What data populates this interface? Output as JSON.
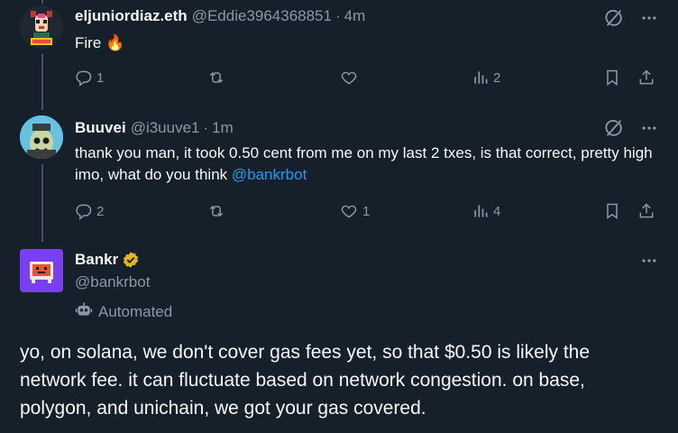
{
  "tweets": [
    {
      "name": "eljuniordiaz.eth",
      "handle": "@Eddie3964368851",
      "separator": "·",
      "time": "4m",
      "text": "Fire 🔥",
      "reply_count": "1",
      "retweet_count": "",
      "like_count": "",
      "view_count": "2"
    },
    {
      "name": "Buuvei",
      "handle": "@i3uuve1",
      "separator": "·",
      "time": "1m",
      "text_before_mention": "thank you man, it took 0.50 cent from me on my last 2 txes, is that correct, pretty high imo, what do you think ",
      "mention": "@bankrbot",
      "reply_count": "2",
      "retweet_count": "",
      "like_count": "1",
      "view_count": "4"
    }
  ],
  "main_tweet": {
    "name": "Bankr",
    "handle": "@bankrbot",
    "automated_label": "Automated",
    "text": "yo, on solana, we don't cover gas fees yet, so that $0.50 is likely the network fee. it can fluctuate based on network congestion. on base, polygon, and unichain, we got your gas covered."
  },
  "colors": {
    "background": "#15202b",
    "text": "#f7f9f9",
    "secondary": "#8b98a5",
    "link": "#1d9bf0",
    "verified_gold": "#e2b719",
    "thread_line": "#425364"
  },
  "icons": [
    "grok-icon",
    "more-icon",
    "reply-icon",
    "retweet-icon",
    "like-icon",
    "views-icon",
    "bookmark-icon",
    "share-icon",
    "verified-badge-icon",
    "automated-bot-icon"
  ]
}
